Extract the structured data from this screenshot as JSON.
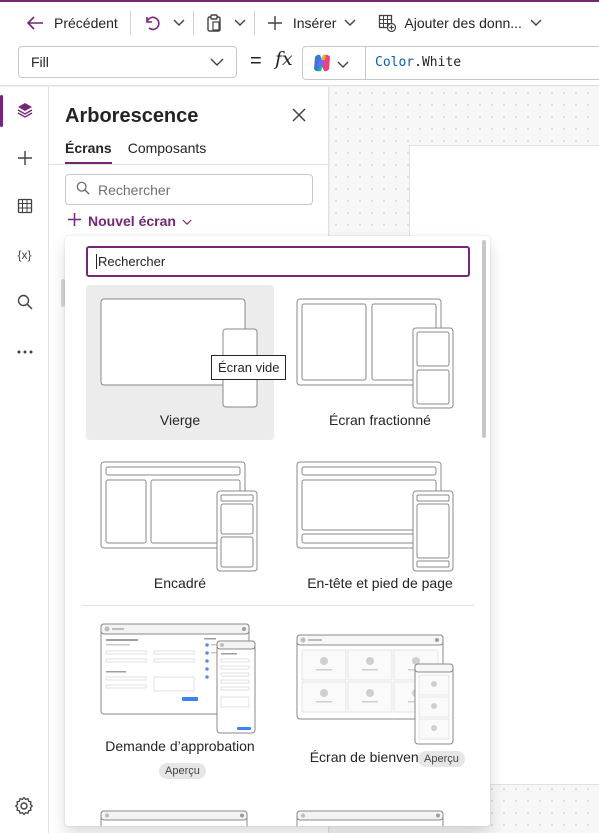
{
  "toolbar": {
    "back_label": "Précédent",
    "insert_label": "Insérer",
    "add_data_label": "Ajouter des donn..."
  },
  "formula_bar": {
    "property": "Fill",
    "equals": "=",
    "fx": "fx",
    "formula_ident": "Color",
    "formula_member": ".White"
  },
  "rail": {
    "items": [
      "tree-view-icon",
      "insert-icon",
      "data-icon",
      "variables-icon",
      "search-icon",
      "more-icon"
    ],
    "variables_label": "{x}"
  },
  "tree_panel": {
    "title": "Arborescence",
    "tabs": [
      {
        "label": "Écrans",
        "active": true
      },
      {
        "label": "Composants",
        "active": false
      }
    ],
    "search_placeholder": "Rechercher",
    "new_screen_label": "Nouvel écran"
  },
  "gallery": {
    "search_placeholder": "Rechercher",
    "tooltip": "Écran vide",
    "templates": [
      {
        "label": "Vierge",
        "selected": true
      },
      {
        "label": "Écran fractionné"
      },
      {
        "label": "Encadré"
      },
      {
        "label": "En-tête et pied de page"
      },
      {
        "label": "Demande d’approbation",
        "badge": "Aperçu"
      },
      {
        "label": "Écran de bienvenue",
        "badge": "Aperçu"
      }
    ]
  },
  "colors": {
    "accent": "#742774",
    "selected_tile": "#ececec"
  }
}
